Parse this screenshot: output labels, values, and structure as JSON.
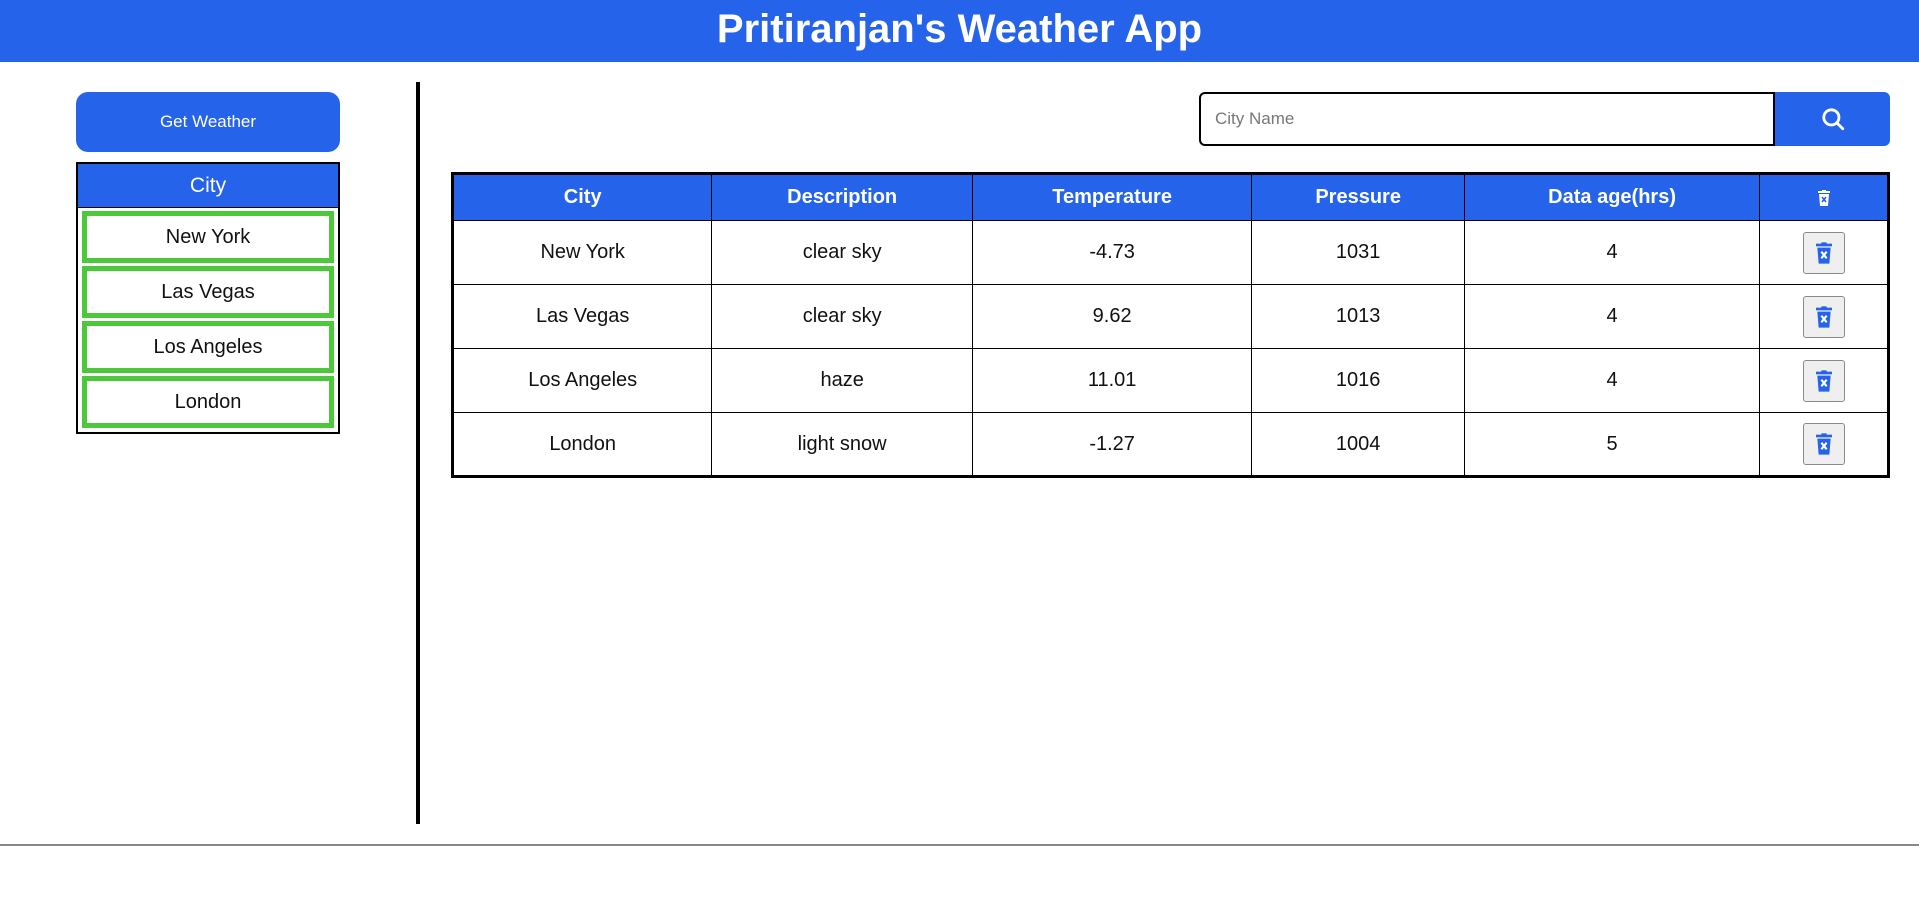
{
  "app": {
    "title": "Pritiranjan's Weather App"
  },
  "sidebar": {
    "get_weather_label": "Get Weather",
    "list_header": "City",
    "cities": [
      "New York",
      "Las Vegas",
      "Los Angeles",
      "London"
    ]
  },
  "search": {
    "placeholder": "City Name",
    "value": "",
    "button_icon": "search-icon"
  },
  "table": {
    "headers": {
      "city": "City",
      "description": "Description",
      "temperature": "Temperature",
      "pressure": "Pressure",
      "data_age": "Data age(hrs)",
      "delete_all_icon": "trash-icon"
    },
    "rows": [
      {
        "city": "New York",
        "description": "clear sky",
        "temperature": "-4.73",
        "pressure": "1031",
        "data_age": "4"
      },
      {
        "city": "Las Vegas",
        "description": "clear sky",
        "temperature": "9.62",
        "pressure": "1013",
        "data_age": "4"
      },
      {
        "city": "Los Angeles",
        "description": "haze",
        "temperature": "11.01",
        "pressure": "1016",
        "data_age": "4"
      },
      {
        "city": "London",
        "description": "light snow",
        "temperature": "-1.27",
        "pressure": "1004",
        "data_age": "5"
      }
    ],
    "row_delete_icon": "trash-icon"
  },
  "colors": {
    "primary": "#2563eb",
    "city_item_border": "#4cc93a",
    "header_text": "#ffffff"
  }
}
